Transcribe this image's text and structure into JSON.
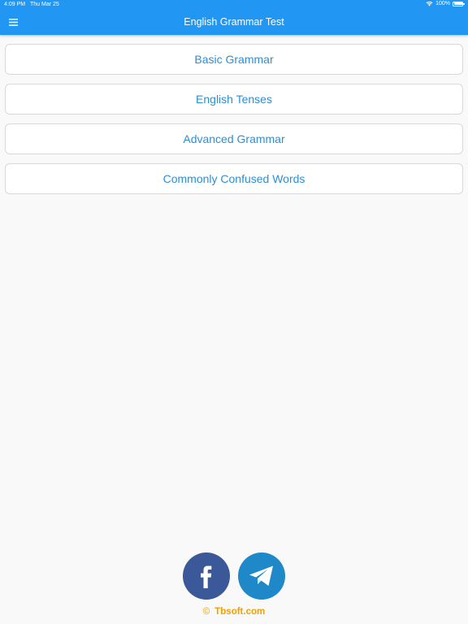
{
  "status_bar": {
    "time": "4:09 PM",
    "date": "Thu Mar 25",
    "battery": "100%"
  },
  "header": {
    "title": "English Grammar Test",
    "menu_icon": "hamburger-menu-icon"
  },
  "menu": {
    "items": [
      {
        "label": "Basic Grammar"
      },
      {
        "label": "English Tenses"
      },
      {
        "label": "Advanced Grammar"
      },
      {
        "label": "Commonly Confused Words"
      }
    ]
  },
  "social": {
    "facebook_icon": "facebook-icon",
    "telegram_icon": "telegram-icon"
  },
  "footer": {
    "copyright_symbol": "©",
    "site": "Tbsoft.com"
  },
  "colors": {
    "header": "#2196f3",
    "link_text": "#2a8fd8",
    "footer_text": "#f0a000",
    "facebook": "#3b5998",
    "telegram": "#1e88c8"
  }
}
